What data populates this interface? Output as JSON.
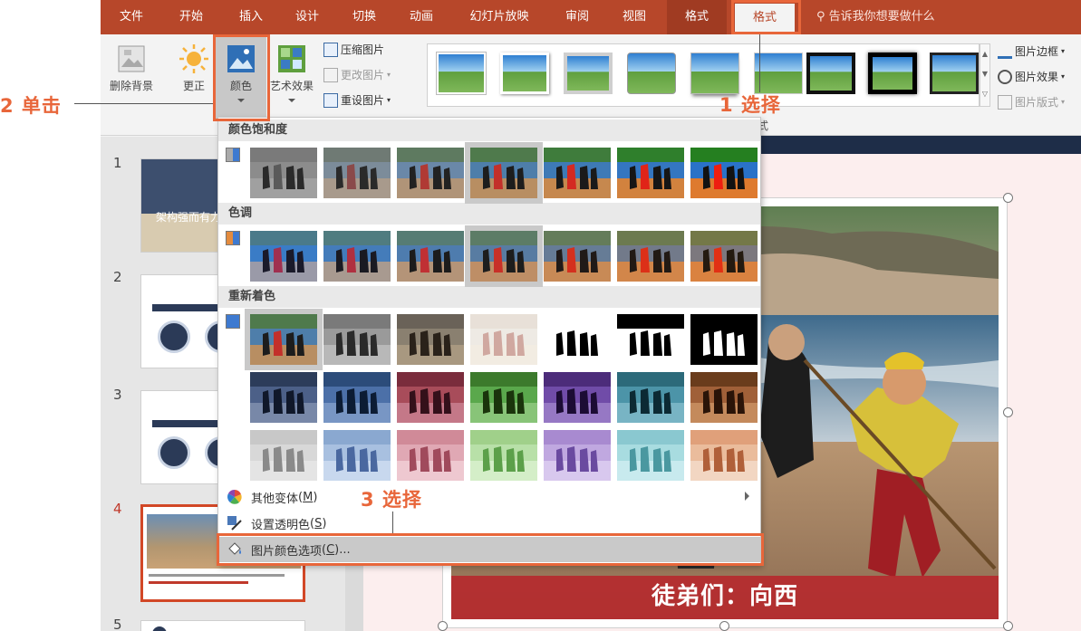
{
  "tabs": [
    "文件",
    "开始",
    "插入",
    "设计",
    "切换",
    "动画",
    "幻灯片放映",
    "审阅",
    "视图",
    "格式",
    "格式"
  ],
  "tell_me": "告诉我你想要做什么",
  "ribbon": {
    "remove_background": "删除背景",
    "corrections": "更正",
    "color": "颜色",
    "artistic_effects": "艺术效果",
    "compress_pictures": "压缩图片",
    "change_picture": "更改图片",
    "reset_picture": "重设图片",
    "picture_border": "图片边框",
    "picture_effects": "图片效果",
    "picture_layout": "图片版式",
    "group_label_partial": "式"
  },
  "dropdown": {
    "saturation_title": "颜色饱和度",
    "tone_title": "色调",
    "recolor_title": "重新着色",
    "more_variations": "其他变体",
    "more_variations_key": "M",
    "set_transparent": "设置透明色",
    "set_transparent_key": "S",
    "picture_color_options": "图片颜色选项",
    "picture_color_options_key": "C",
    "picture_color_options_suffix": "..."
  },
  "thumbnails": [
    {
      "number": "1",
      "title": "架构强而有力"
    },
    {
      "number": "2"
    },
    {
      "number": "3"
    },
    {
      "number": "4"
    },
    {
      "number": "5"
    }
  ],
  "slide": {
    "caption": "徒弟们：向西"
  },
  "annotations": {
    "step1": "1 选择",
    "step2": "2 单击",
    "step3": "3 选择"
  },
  "colors": {
    "accent": "#b7472a",
    "annotation": "#e8663a",
    "selection": "#d24726"
  }
}
